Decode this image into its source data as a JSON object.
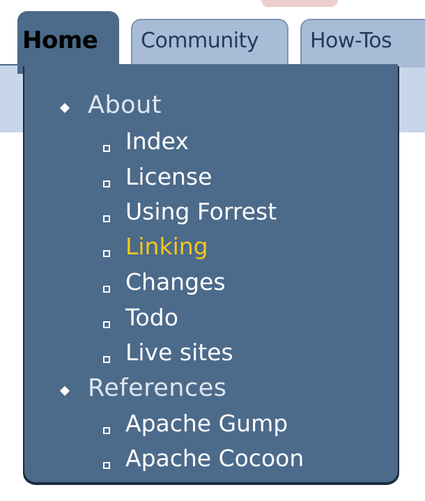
{
  "tabs": {
    "home": "Home",
    "community": "Community",
    "howtos": "How-Tos"
  },
  "menu": {
    "groups": [
      {
        "label": "About",
        "items": [
          "Index",
          "License",
          "Using Forrest",
          "Linking",
          "Changes",
          "Todo",
          "Live sites"
        ]
      },
      {
        "label": "References",
        "items": [
          "Apache Gump",
          "Apache Cocoon"
        ]
      }
    ],
    "selected_item": "Linking"
  },
  "colors": {
    "panel": "#4c6a8a",
    "tab_inactive": "#a9bcd7",
    "selected_text": "#f3c81b",
    "text": "#ffffff"
  },
  "icons": {
    "group_bullet": "diamond-bullet-icon",
    "item_bullet": "square-bullet-icon"
  }
}
